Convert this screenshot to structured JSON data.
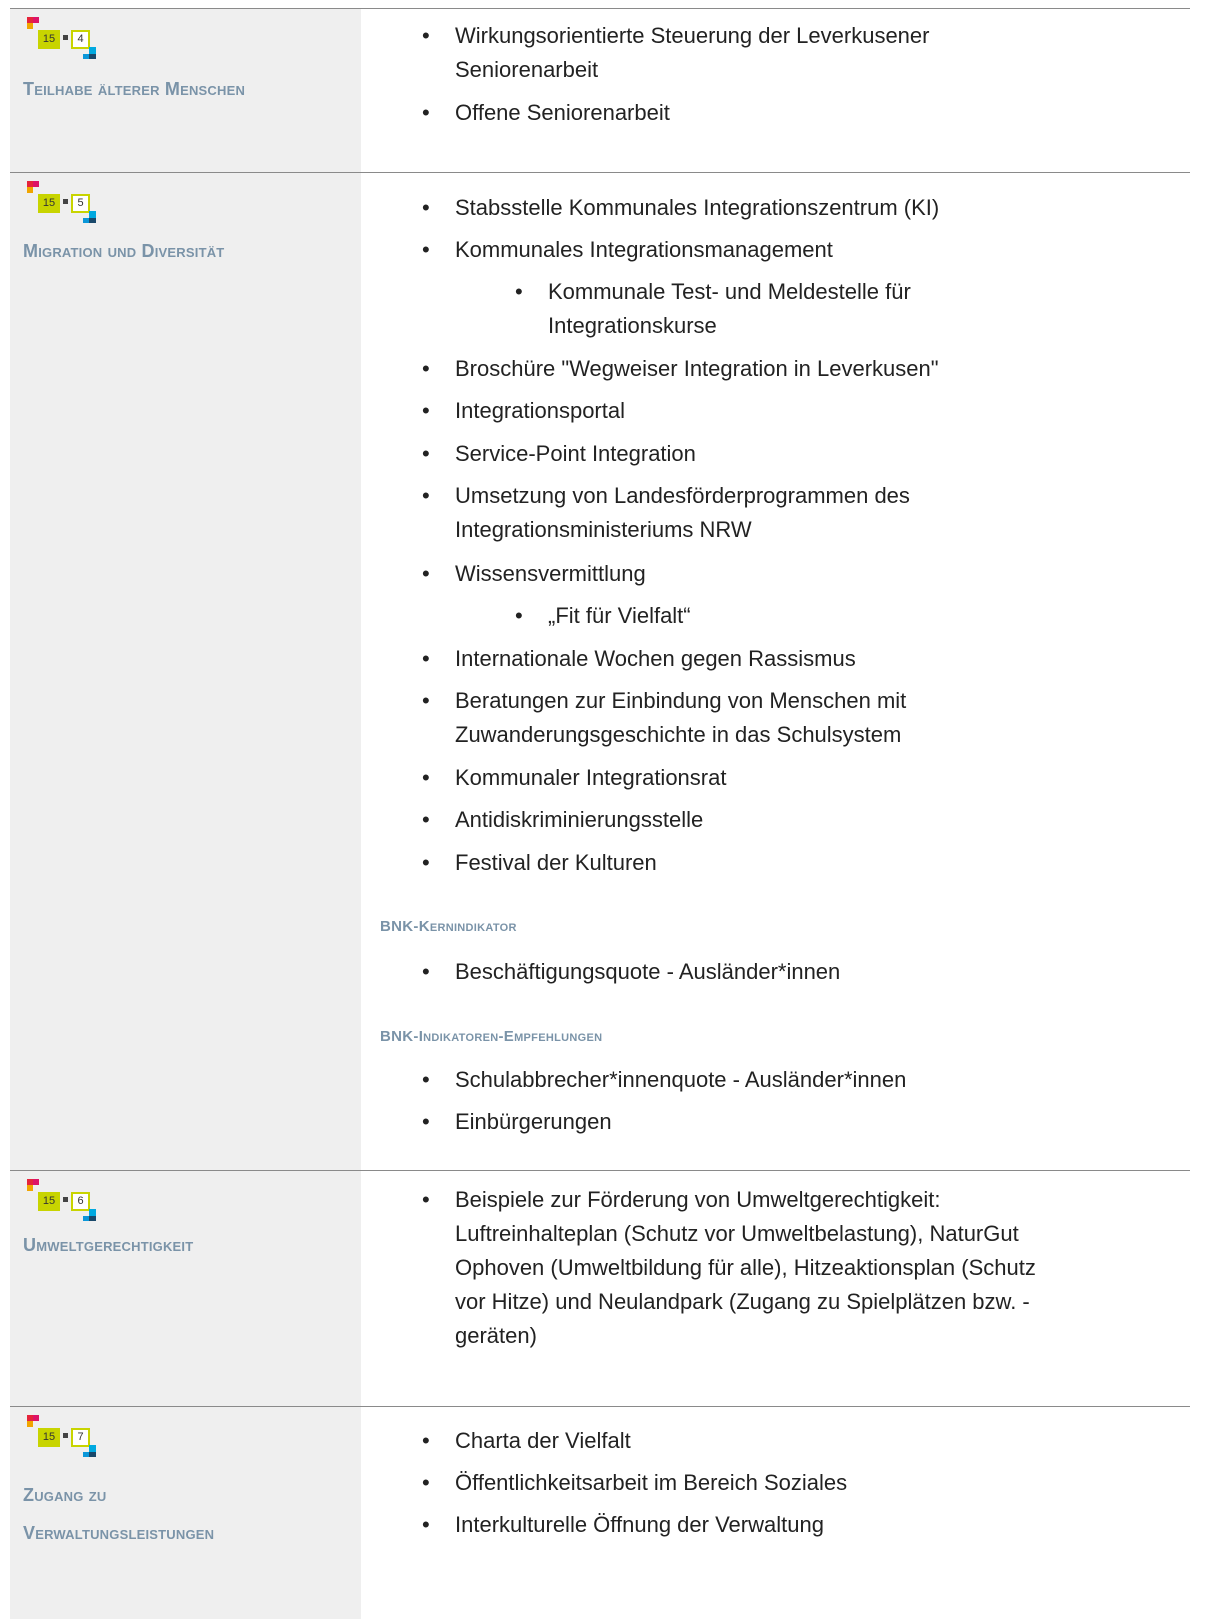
{
  "sections": [
    {
      "badge_num": "4",
      "title_lines": [
        "Teilhabe älterer Menschen"
      ],
      "items": [
        {
          "text": "Wirkungsorientierte Steuerung der Leverkusener\nSeniorenarbeit"
        },
        {
          "text": "Offene Seniorenarbeit"
        }
      ]
    },
    {
      "badge_num": "5",
      "title_lines": [
        "Migration und Diversität"
      ],
      "items": [
        {
          "text": "Stabsstelle Kommunales Integrationszentrum (KI)"
        },
        {
          "text": "Kommunales Integrationsmanagement"
        },
        {
          "text": "Kommunale Test- und Meldestelle für\nIntegrationskurse"
        },
        {
          "text": "Broschüre \"Wegweiser Integration in Leverkusen\""
        },
        {
          "text": "Integrationsportal"
        },
        {
          "text": "Service-Point Integration"
        },
        {
          "text": "Umsetzung von Landesförderprogrammen des\nIntegrationsministeriums NRW"
        },
        {
          "text": "Wissensvermittlung"
        },
        {
          "text": "„Fit für Vielfalt“"
        },
        {
          "text": "Internationale Wochen gegen Rassismus"
        },
        {
          "text": "Beratungen zur Einbindung von Menschen mit\nZuwanderungsgeschichte in das Schulsystem"
        },
        {
          "text": "Kommunaler Integrationsrat"
        },
        {
          "text": "Antidiskriminierungsstelle"
        },
        {
          "text": "Festival der Kulturen"
        }
      ],
      "kernindikator_heading": "BNK-Kernindikator",
      "kernindikator_items": [
        "Beschäftigungsquote - Ausländer*innen"
      ],
      "empfehlungen_heading": "BNK-Indikatoren-Empfehlungen",
      "empfehlungen_items": [
        "Schulabbrecher*innenquote - Ausländer*innen",
        "Einbürgerungen"
      ]
    },
    {
      "badge_num": "6",
      "title_lines": [
        "Umweltgerechtigkeit"
      ],
      "items": [
        {
          "text": "Beispiele zur Förderung von Umweltgerechtigkeit:\nLuftreinhalteplan (Schutz vor Umweltbelastung), NaturGut\nOphoven (Umweltbildung für alle), Hitzeaktionsplan (Schutz\nvor Hitze) und Neulandpark (Zugang zu Spielplätzen bzw. -\ngeräten)"
        }
      ]
    },
    {
      "badge_num": "7",
      "title_lines": [
        "Zugang zu",
        "Verwaltungsleistungen"
      ],
      "items": [
        {
          "text": "Charta der Vielfalt"
        },
        {
          "text": "Öffentlichkeitsarbeit im Bereich Soziales"
        },
        {
          "text": "Interkulturelle Öffnung der Verwaltung"
        }
      ]
    }
  ],
  "badge_prefix": "15",
  "bullet": "•",
  "colors": {
    "accent_green": "#c8d400",
    "heading_blue": "#7a93a8",
    "panel_gray": "#efefef"
  }
}
